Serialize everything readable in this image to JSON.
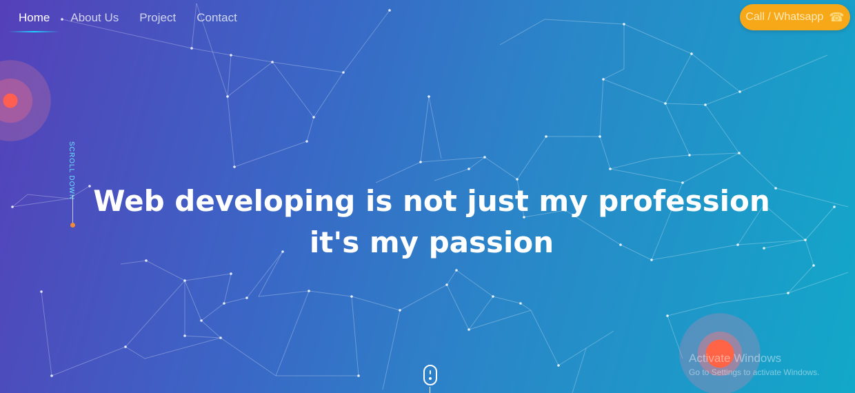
{
  "nav": {
    "items": [
      {
        "label": "Home",
        "active": true
      },
      {
        "label": "About Us",
        "active": false
      },
      {
        "label": "Project",
        "active": false
      },
      {
        "label": "Contact",
        "active": false
      }
    ]
  },
  "cta": {
    "label": "Call / Whatsapp",
    "icon": "phone-icon",
    "color": "#f6a818"
  },
  "scroll_hint": {
    "label": "SCROLL DOWN"
  },
  "hero": {
    "line1": "Web developing is not just my profession",
    "line2": "it's my passion"
  },
  "watermark": {
    "title": "Activate Windows",
    "subtitle": "Go to Settings to activate Windows."
  },
  "colors": {
    "gradient_start": "#5540b9",
    "gradient_end": "#12a8c9",
    "accent_cyan": "#1fd6ff",
    "orb": "#ff5f50"
  }
}
